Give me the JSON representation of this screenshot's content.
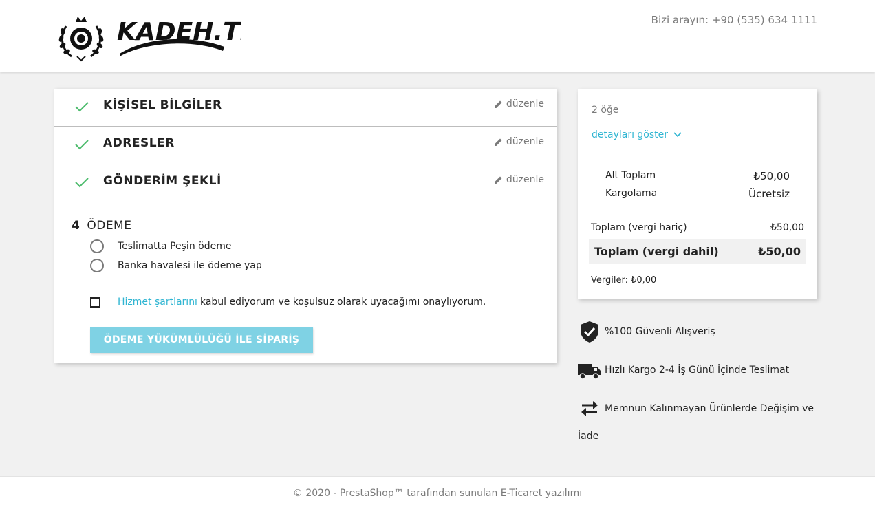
{
  "header": {
    "logo_text": "KADEH.TR",
    "phone_label": "Bizi arayın:",
    "phone_number": "+90 (535) 634 1111"
  },
  "checkout": {
    "steps": [
      {
        "title": "KİŞİSEL BİLGİLER",
        "edit_label": "düzenle"
      },
      {
        "title": "ADRESLER",
        "edit_label": "düzenle"
      },
      {
        "title": "GÖNDERİM ŞEKLİ",
        "edit_label": "düzenle"
      }
    ],
    "payment": {
      "number": "4",
      "title": "ÖDEME",
      "options": [
        "Teslimatta Peşin ödeme",
        "Banka havalesi ile ödeme yap"
      ],
      "terms_link": "Hizmet şartlarını",
      "terms_text": "kabul ediyorum ve koşulsuz olarak uyacağımı onaylıyorum.",
      "order_button": "ÖDEME YÜKÜMLÜLÜĞÜ İLE SİPARİŞ"
    }
  },
  "summary": {
    "item_count": "2 öğe",
    "show_details": "detayları göster",
    "subtotal_label": "Alt Toplam",
    "subtotal_value": "₺50,00",
    "shipping_label": "Kargolama",
    "shipping_value": "Ücretsiz",
    "total_excl_label": "Toplam (vergi hariç)",
    "total_excl_value": "₺50,00",
    "total_incl_label": "Toplam (vergi dahil)",
    "total_incl_value": "₺50,00",
    "taxes": "Vergiler: ₺0,00"
  },
  "reassurance": [
    {
      "icon": "shield-check-icon",
      "text": "%100 Güvenli Alışveriş"
    },
    {
      "icon": "truck-icon",
      "text": "Hızlı Kargo 2-4 İş Günü İçinde Teslimat"
    },
    {
      "icon": "exchange-arrows-icon",
      "text": "Memnun Kalınmayan Ürünlerde Değişim ve",
      "text2": "İade"
    }
  ],
  "footer": {
    "copyright": "© 2020 - PrestaShop™ tarafından sunulan E-Ticaret yazılımı"
  },
  "colors": {
    "accent": "#2fb5d2",
    "button": "#7fd2e4",
    "check": "#4cbb6c",
    "background": "#f1f1f1"
  }
}
